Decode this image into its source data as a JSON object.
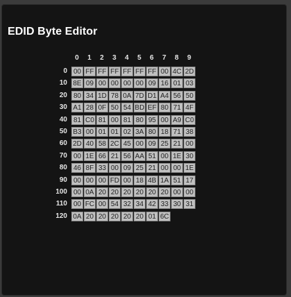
{
  "title": "EDID Byte Editor",
  "columns": [
    "0",
    "1",
    "2",
    "3",
    "4",
    "5",
    "6",
    "7",
    "8",
    "9"
  ],
  "rows": [
    {
      "label": "0",
      "bytes": [
        "00",
        "FF",
        "FF",
        "FF",
        "FF",
        "FF",
        "FF",
        "00",
        "4C",
        "2D"
      ]
    },
    {
      "label": "10",
      "bytes": [
        "8E",
        "09",
        "00",
        "00",
        "00",
        "00",
        "09",
        "16",
        "01",
        "03"
      ]
    },
    {
      "label": "20",
      "bytes": [
        "80",
        "34",
        "1D",
        "78",
        "0A",
        "7D",
        "D1",
        "A4",
        "56",
        "50"
      ]
    },
    {
      "label": "30",
      "bytes": [
        "A1",
        "28",
        "0F",
        "50",
        "54",
        "BD",
        "EF",
        "80",
        "71",
        "4F"
      ]
    },
    {
      "label": "40",
      "bytes": [
        "81",
        "C0",
        "81",
        "00",
        "81",
        "80",
        "95",
        "00",
        "A9",
        "C0"
      ]
    },
    {
      "label": "50",
      "bytes": [
        "B3",
        "00",
        "01",
        "01",
        "02",
        "3A",
        "80",
        "18",
        "71",
        "38"
      ]
    },
    {
      "label": "60",
      "bytes": [
        "2D",
        "40",
        "58",
        "2C",
        "45",
        "00",
        "09",
        "25",
        "21",
        "00"
      ]
    },
    {
      "label": "70",
      "bytes": [
        "00",
        "1E",
        "66",
        "21",
        "56",
        "AA",
        "51",
        "00",
        "1E",
        "30"
      ]
    },
    {
      "label": "80",
      "bytes": [
        "46",
        "8F",
        "33",
        "00",
        "09",
        "25",
        "21",
        "00",
        "00",
        "1E"
      ]
    },
    {
      "label": "90",
      "bytes": [
        "00",
        "00",
        "00",
        "FD",
        "00",
        "18",
        "4B",
        "1A",
        "51",
        "17"
      ]
    },
    {
      "label": "100",
      "bytes": [
        "00",
        "0A",
        "20",
        "20",
        "20",
        "20",
        "20",
        "20",
        "00",
        "00"
      ]
    },
    {
      "label": "110",
      "bytes": [
        "00",
        "FC",
        "00",
        "54",
        "32",
        "34",
        "42",
        "33",
        "30",
        "31"
      ]
    },
    {
      "label": "120",
      "bytes": [
        "0A",
        "20",
        "20",
        "20",
        "20",
        "20",
        "01",
        "6C"
      ]
    }
  ]
}
